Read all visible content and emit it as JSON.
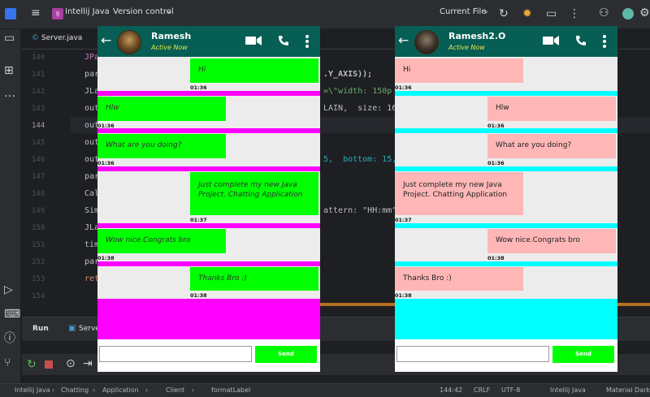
{
  "ide": {
    "project_badge": "IJ",
    "project_name": "Intellij Java",
    "vcs": "Version control",
    "run_config": "Current File",
    "editor_tab": "Server.java",
    "line_numbers": [
      "140",
      "141",
      "142",
      "143",
      "144",
      "145",
      "146",
      "147",
      "148",
      "149",
      "150",
      "151",
      "152",
      "153",
      "154"
    ],
    "code_lines": [
      {
        "text": "JPa",
        "suffix": ""
      },
      {
        "text": "par",
        "suffix": ".Y_AXIS));"
      },
      {
        "text": "JLa",
        "suffix": "=\\\"width: 150p"
      },
      {
        "text": "out",
        "suffix": "LAIN,  size: 16));"
      },
      {
        "text": "out",
        "suffix": ""
      },
      {
        "text": "out",
        "suffix": ""
      },
      {
        "text": "out",
        "suffix": "5,  bottom: 15,"
      },
      {
        "text": "par",
        "suffix": ""
      },
      {
        "text": "Cal",
        "suffix": ""
      },
      {
        "text": "Sim",
        "suffix": "attern: \"HH:mm\");"
      },
      {
        "text": "JLa",
        "suffix": ""
      },
      {
        "text": "tim",
        "suffix": ""
      },
      {
        "text": "par",
        "suffix": ""
      },
      {
        "text": "ret",
        "suffix": ""
      },
      {
        "text": "",
        "suffix": ""
      }
    ],
    "run_tab": "Run",
    "run_target": "Serve",
    "accent": "#b4701f"
  },
  "status": {
    "breadcrumb": [
      "Intellij Java",
      "Chatting",
      "Application",
      "Client",
      "formatLabel"
    ],
    "position": "144:42",
    "line_sep": "CRLF",
    "encoding": "UTF-8",
    "project": "Intellij Java",
    "theme": "Material Dark"
  },
  "chats": [
    {
      "name": "Ramesh",
      "status": "Active Now",
      "send_label": "Send",
      "input_value": "",
      "sep_color": "#ff00ff",
      "bubble_color": "#00ff00",
      "messages": [
        {
          "text": "Hi",
          "time": "01:36",
          "side": "right"
        },
        {
          "text": "Hlw",
          "time": "01:36",
          "side": "left"
        },
        {
          "text": "What are you doing?",
          "time": "01:36",
          "side": "left"
        },
        {
          "text": "Just complete my new Java Project. Chatting Application",
          "time": "01:37",
          "side": "right"
        },
        {
          "text": "Wow nice.Congrats bro",
          "time": "01:38",
          "side": "left"
        },
        {
          "text": "Thanks Bro :)",
          "time": "01:38",
          "side": "right"
        }
      ]
    },
    {
      "name": "Ramesh2.O",
      "status": "Active Now",
      "send_label": "Send",
      "input_value": "",
      "sep_color": "#00ffff",
      "bubble_color": "#ffb6b6",
      "messages": [
        {
          "text": "Hi",
          "time": "01:36",
          "side": "left"
        },
        {
          "text": "Hlw",
          "time": "01:36",
          "side": "right"
        },
        {
          "text": "What are you doing?",
          "time": "01:36",
          "side": "right"
        },
        {
          "text": "Just complete my new Java Project. Chatting Application",
          "time": "01:37",
          "side": "left"
        },
        {
          "text": "Wow nice.Congrats bro",
          "time": "01:38",
          "side": "right"
        },
        {
          "text": "Thanks Bro :)",
          "time": "01:38",
          "side": "left"
        }
      ]
    }
  ]
}
